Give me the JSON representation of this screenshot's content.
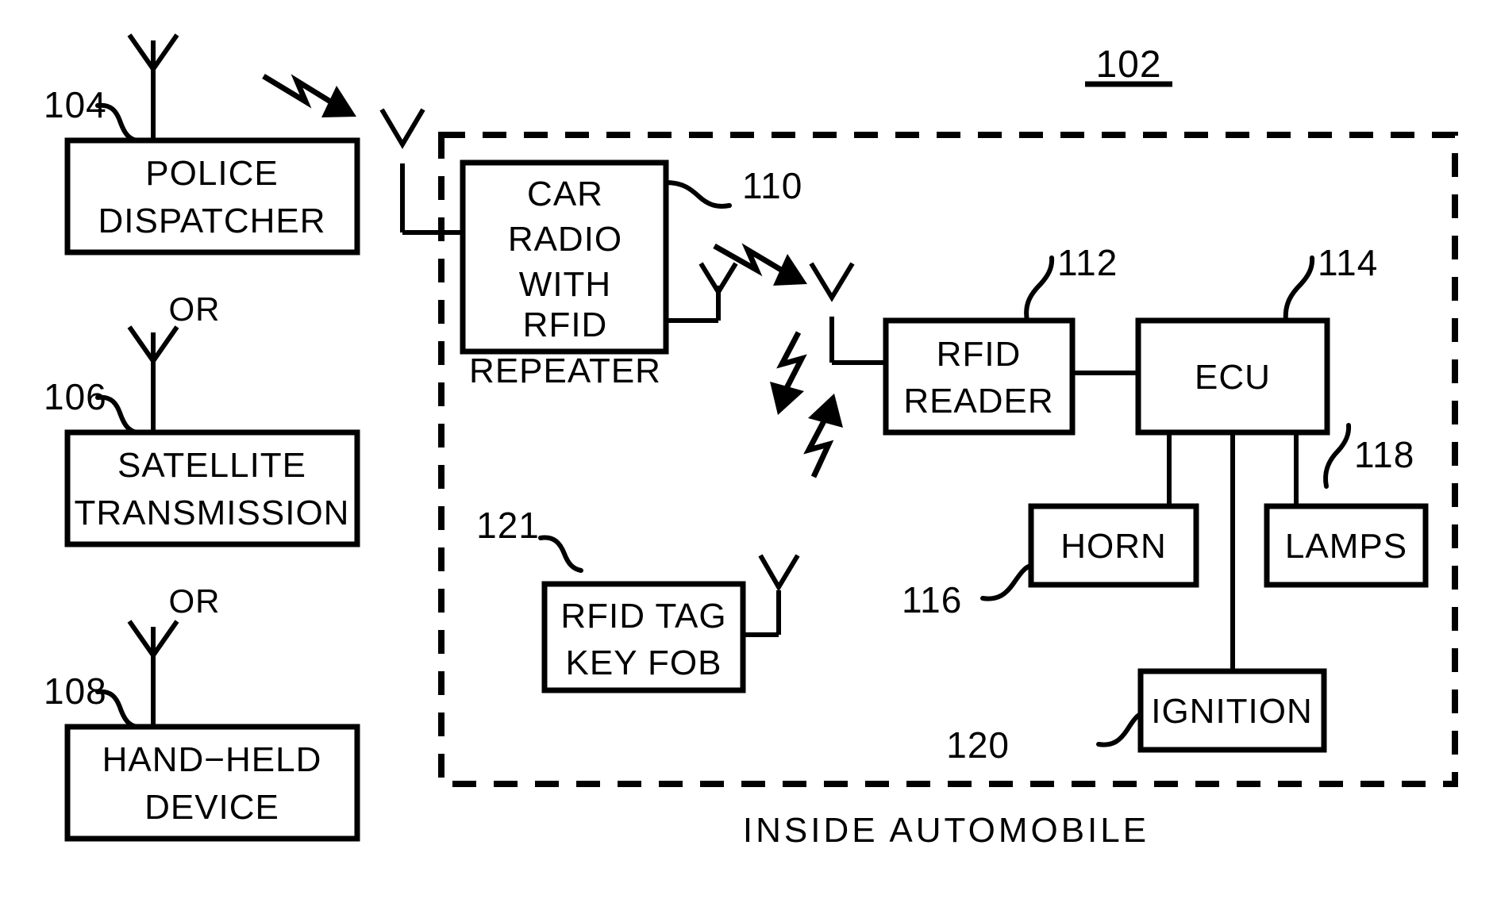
{
  "figure": {
    "figure_ref": "102",
    "caption": "INSIDE  AUTOMOBILE",
    "connector_or_1": "OR",
    "connector_or_2": "OR"
  },
  "blocks": {
    "police_dispatcher": {
      "ref": "104",
      "line1": "POLICE",
      "line2": "DISPATCHER"
    },
    "satellite_transmission": {
      "ref": "106",
      "line1": "SATELLITE",
      "line2": "TRANSMISSION"
    },
    "hand_held_device": {
      "ref": "108",
      "line1": "HAND−HELD",
      "line2": "DEVICE"
    },
    "car_radio": {
      "ref": "110",
      "line1": "CAR",
      "line2": "RADIO",
      "line3": "WITH",
      "line4": "RFID",
      "line5": "REPEATER"
    },
    "rfid_reader": {
      "ref": "112",
      "line1": "RFID",
      "line2": "READER"
    },
    "ecu": {
      "ref": "114",
      "line1": "ECU"
    },
    "horn": {
      "ref": "116",
      "line1": "HORN"
    },
    "lamps": {
      "ref": "118",
      "line1": "LAMPS"
    },
    "ignition": {
      "ref": "120",
      "line1": "IGNITION"
    },
    "rfid_tag_key_fob": {
      "ref": "121",
      "line1": "RFID  TAG",
      "line2": "KEY  FOB"
    }
  },
  "colors": {
    "ink": "#000000",
    "paper": "#ffffff"
  }
}
